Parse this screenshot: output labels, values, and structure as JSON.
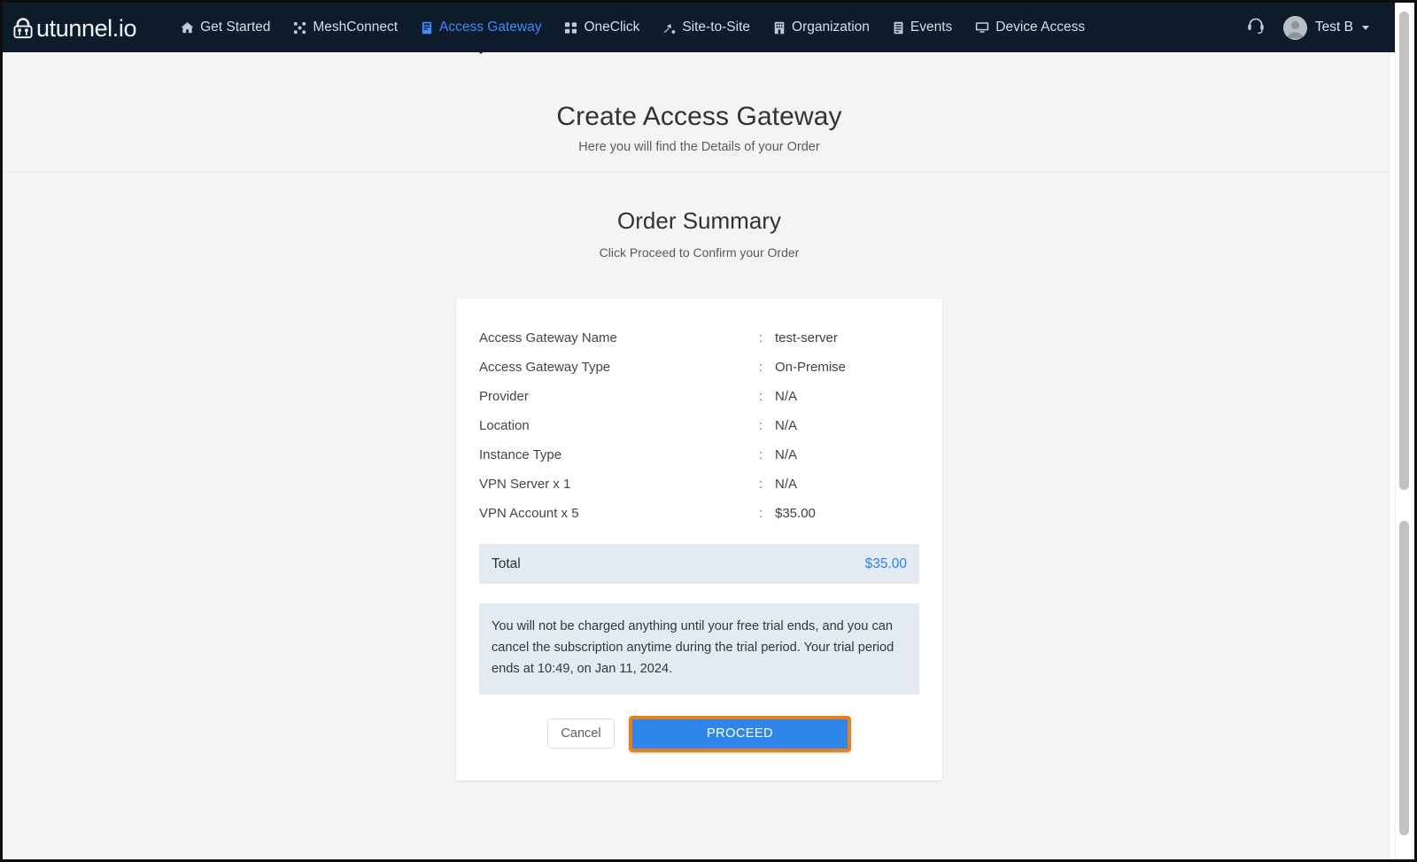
{
  "brand": {
    "icon": "padlock-logo-icon",
    "text": "utunnel.io"
  },
  "navbar": {
    "items": [
      {
        "label": "Get Started",
        "icon": "home-icon",
        "active": false
      },
      {
        "label": "MeshConnect",
        "icon": "mesh-icon",
        "active": false
      },
      {
        "label": "Access Gateway",
        "icon": "server-icon",
        "active": true
      },
      {
        "label": "OneClick",
        "icon": "grid-dots-icon",
        "active": false
      },
      {
        "label": "Site-to-Site",
        "icon": "site-link-icon",
        "active": false
      },
      {
        "label": "Organization",
        "icon": "building-icon",
        "active": false
      },
      {
        "label": "Events",
        "icon": "list-icon",
        "active": false
      },
      {
        "label": "Device Access",
        "icon": "monitor-icon",
        "active": false
      }
    ],
    "support_icon": "headset-icon",
    "user": {
      "avatar_icon": "user-avatar-icon",
      "name": "Test B",
      "caret_icon": "chevron-down-icon"
    },
    "active_indicator_icon": "caret-up-indicator-icon"
  },
  "header": {
    "title": "Create Access Gateway",
    "subtitle": "Here you will find the Details of your Order"
  },
  "order_summary": {
    "title": "Order Summary",
    "subtitle": "Click Proceed to Confirm your Order",
    "separator": ":",
    "rows": [
      {
        "label": "Access Gateway Name",
        "value": "test-server"
      },
      {
        "label": "Access Gateway Type",
        "value": "On-Premise"
      },
      {
        "label": "Provider",
        "value": "N/A"
      },
      {
        "label": "Location",
        "value": "N/A"
      },
      {
        "label": "Instance Type",
        "value": "N/A"
      },
      {
        "label": "VPN Server x 1",
        "value": "N/A"
      },
      {
        "label": "VPN Account x 5",
        "value": "$35.00"
      }
    ],
    "total": {
      "label": "Total",
      "value": "$35.00"
    },
    "notice": "You will not be charged anything until your free trial ends, and you can cancel the subscription anytime during the trial period. Your trial period ends at 10:49, on Jan 11, 2024.",
    "actions": {
      "cancel_label": "Cancel",
      "proceed_label": "PROCEED"
    }
  },
  "colors": {
    "navbar_bg": "#0d1b2a",
    "nav_active": "#3d8bfd",
    "page_bg": "#f4f5f3",
    "card_bg": "#ffffff",
    "total_bg": "#e3eaf2",
    "total_value": "#2f80ed",
    "proceed_bg": "#2f86e8",
    "highlight_border": "#e2811f"
  }
}
